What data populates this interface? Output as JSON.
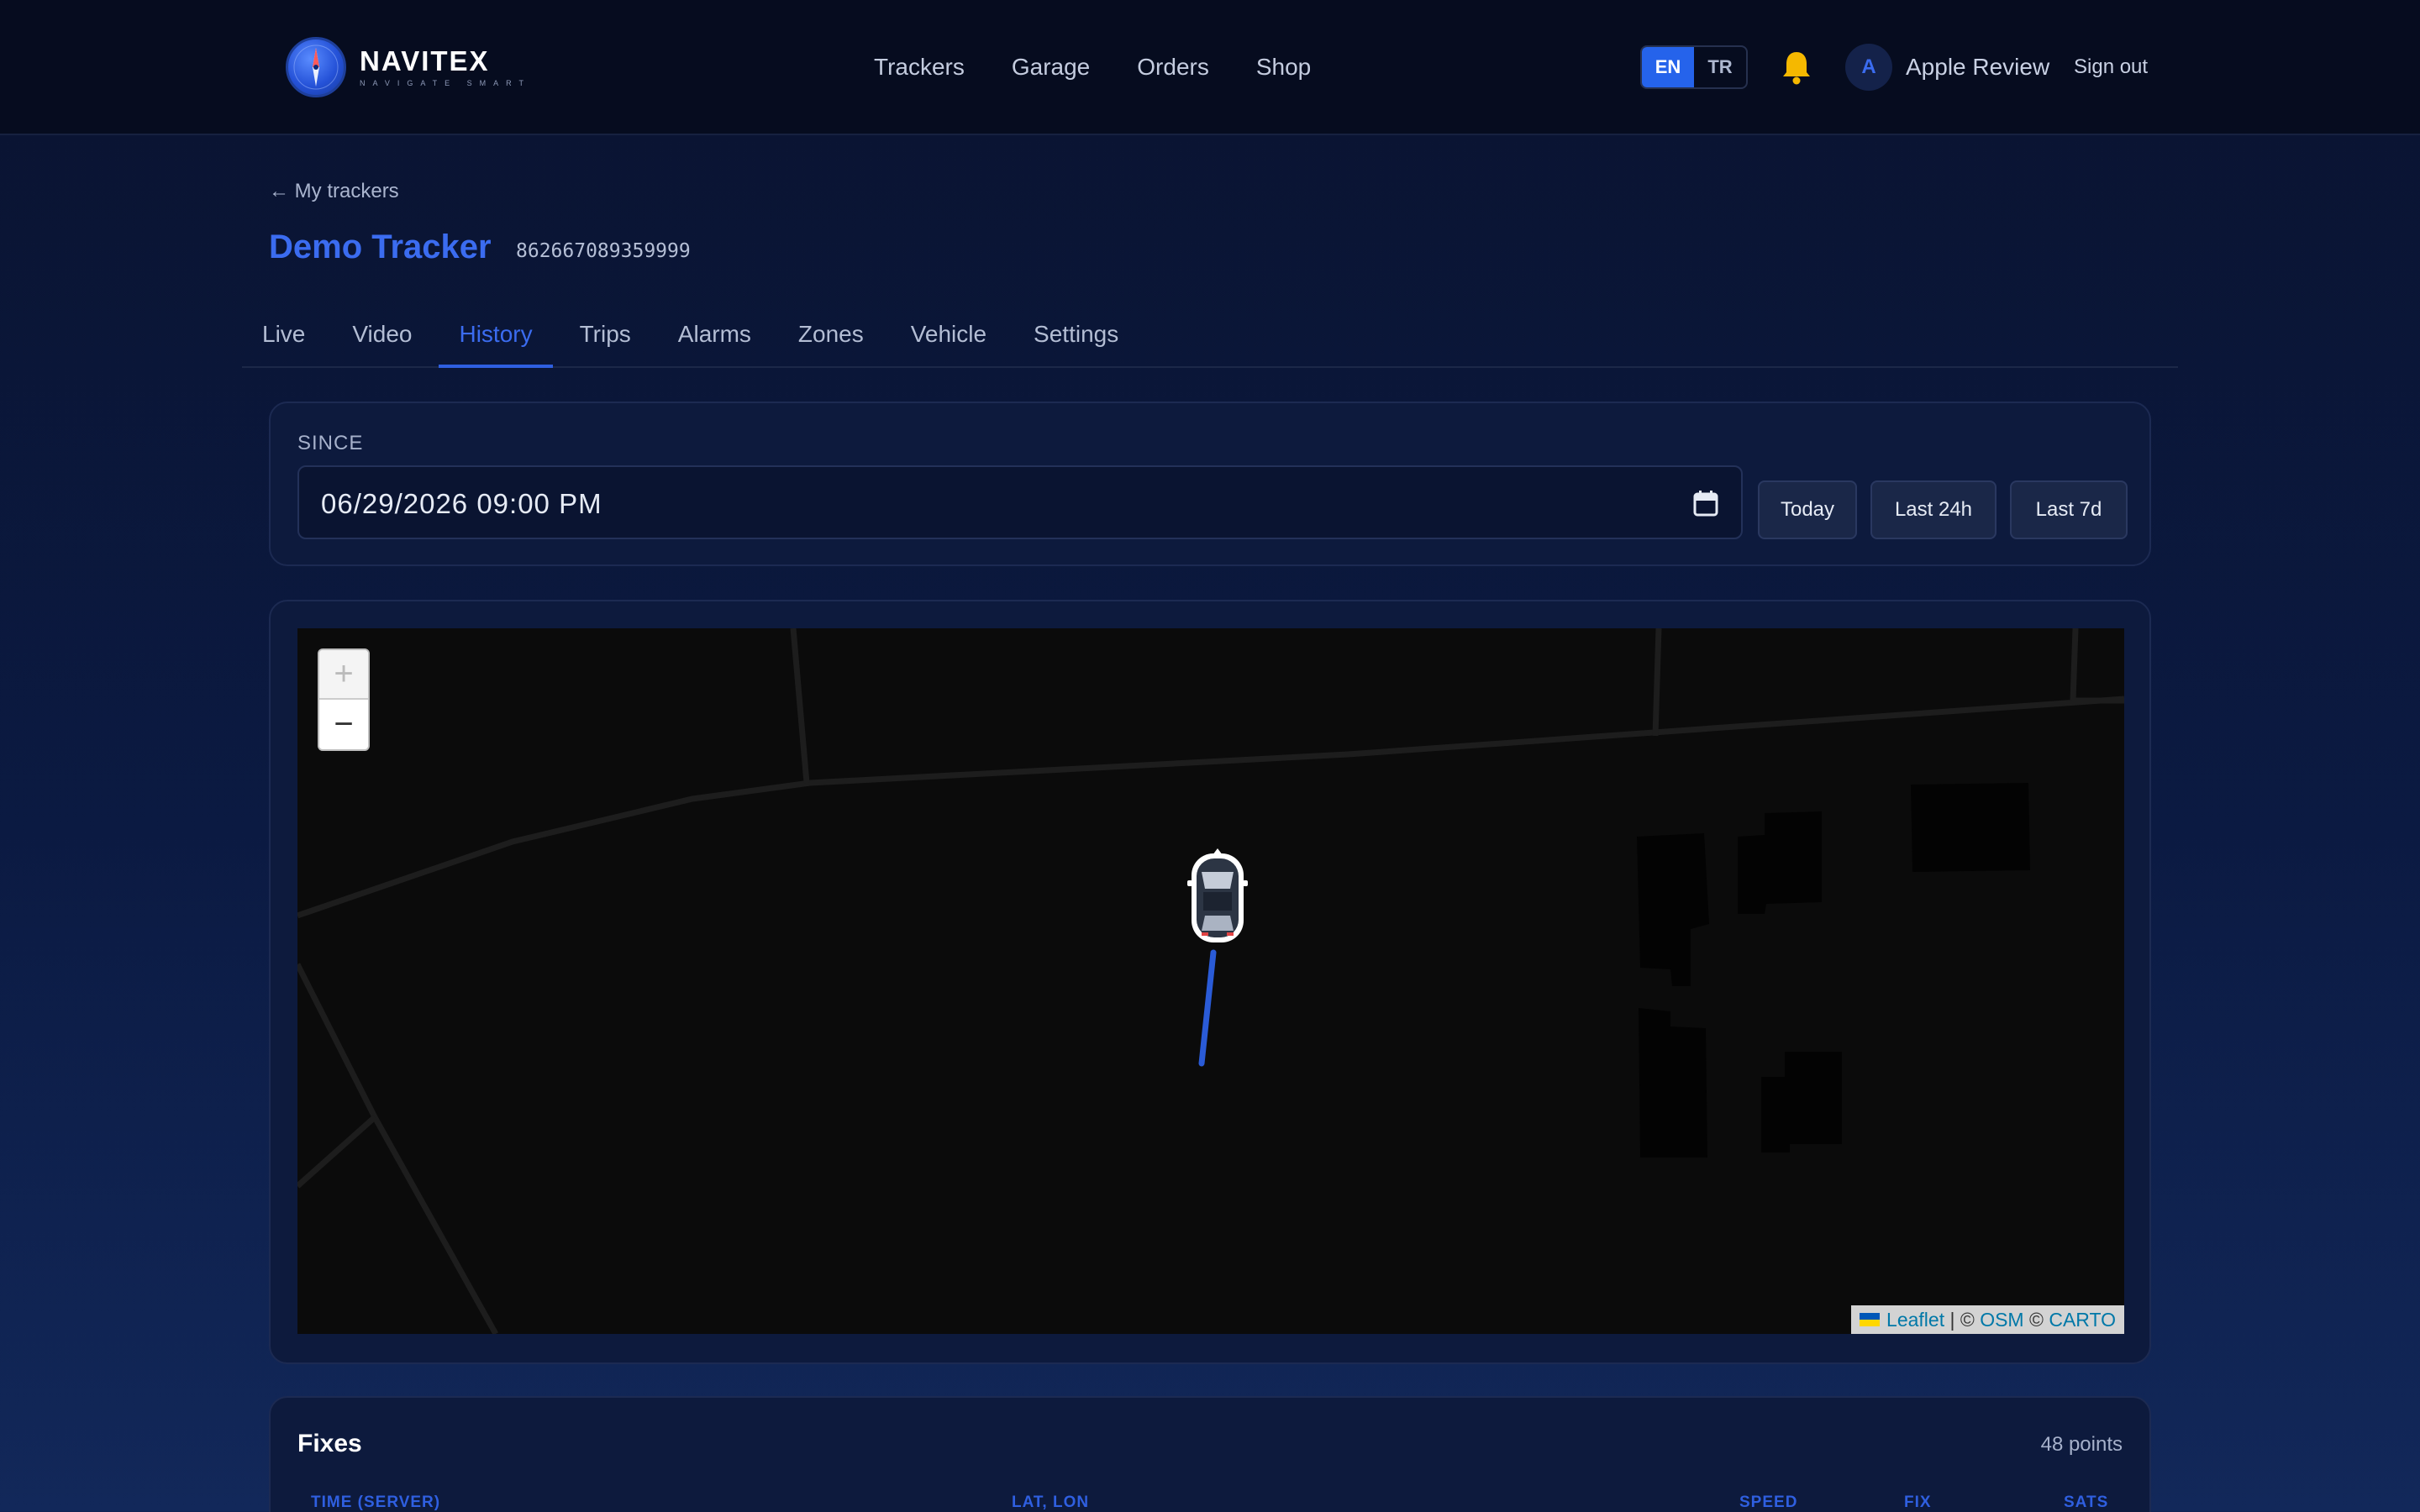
{
  "header": {
    "brand": "NAVITEX",
    "tagline": "NAVIGATE SMART",
    "nav": [
      "Trackers",
      "Garage",
      "Orders",
      "Shop"
    ],
    "lang": {
      "en": "EN",
      "tr": "TR",
      "active": "EN"
    },
    "user": {
      "initial": "A",
      "name": "Apple Review"
    },
    "sign_out": "Sign out"
  },
  "page": {
    "back_link": "My trackers",
    "title": "Demo Tracker",
    "tracker_id": "862667089359999",
    "tabs": [
      "Live",
      "Video",
      "History",
      "Trips",
      "Alarms",
      "Zones",
      "Vehicle",
      "Settings"
    ],
    "active_tab": "History"
  },
  "since": {
    "label": "SINCE",
    "value": "06/29/2026 09:00 PM",
    "buttons": [
      "Today",
      "Last 24h",
      "Last 7d"
    ]
  },
  "map": {
    "zoom_in": "+",
    "zoom_out": "−",
    "attribution": {
      "leaflet": "Leaflet",
      "sep": "|",
      "copy1": "©",
      "osm": "OSM",
      "copy2": "©",
      "carto": "CARTO"
    },
    "track_color": "#2a5bd7",
    "background": "#0b0b0b"
  },
  "fixes": {
    "title": "Fixes",
    "count": "48 points",
    "columns": [
      "TIME (SERVER)",
      "LAT, LON",
      "SPEED",
      "FIX",
      "SATS"
    ]
  },
  "colors": {
    "accent": "#2563eb",
    "bell": "#f5b800"
  }
}
